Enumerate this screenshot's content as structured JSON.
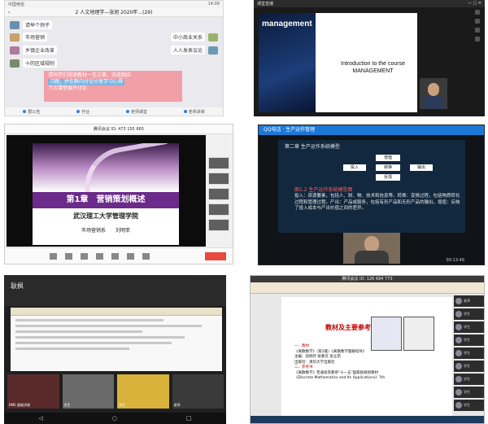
{
  "panel1": {
    "status_left": "中国电信",
    "status_right": "14:09",
    "header_title": "2 人文地理学—张旭 2020年...(29)",
    "messages": [
      "请举个例子",
      "市场营销",
      "中小商业关系",
      "乡镇企业改革",
      "人人发表议论",
      "十的区域规则"
    ],
    "banner_line1": "请同学们阅读教材一至三章，完成相应",
    "banner_line2": "习题，并在群内讨论分享学习心得",
    "banner_line3": "下次课堂展开讨论",
    "bottom_items": [
      "群公告",
      "作业",
      "老师课堂",
      "老师讲课"
    ]
  },
  "panel2": {
    "topbar_title": "课堂直播",
    "slide_word": "management",
    "slide_line1": "Introduction to the course",
    "slide_line2": "MANAGEMENT"
  },
  "panel3": {
    "window_title": "腾讯会议 ID: 473 155 665",
    "chapter_title": "第1章　营销策划概述",
    "university": "武汉理工大学管理学院",
    "department": "市场营销系　　刘明菲",
    "thumb_labels": [
      "",
      "",
      "",
      "",
      ""
    ]
  },
  "panel4": {
    "app_title": "QQ电话 · 生产运作管理",
    "slide_header": "第二章 生产运作系统模型",
    "flow_boxes": [
      "增值",
      "投入",
      "转换",
      "输出",
      "反馈"
    ],
    "section_title": "图1.2 生产运作系统模型图",
    "paragraph": "投入：资源要素，包括人、财、物、技术和信息等。转换：变换过程，包括物质转化过程和管理过程。产出：产品或服务，包括有形产品和无形产品的输出。增值：反映了投入成本与产出价值之间的差异。",
    "time": "00:13:49"
  },
  "panel5": {
    "name": "耿枫",
    "thumb_labels": [
      "BME 超级讲课",
      "学生",
      "学生",
      "老师"
    ]
  },
  "panel6": {
    "window_title": "腾讯会议 ID: 126 694 773",
    "doc_title": "教材及主要参考书",
    "doc_lines": [
      "一、教材",
      "《离散数学》（第2版）《离散数学题解指导》",
      "主编：屈婉玲 耿素云 张立昂",
      "出版社：清华大学出版社",
      "二、参考书",
      "《离散数学》普通高等教育\"十一五\"国家级规划教材",
      "《Discrete Mathematics and Its Applications》7th"
    ],
    "side_labels": [
      "老师",
      "学生",
      "学生",
      "学生",
      "学生",
      "学生",
      "学生",
      "学生",
      "学生"
    ]
  }
}
